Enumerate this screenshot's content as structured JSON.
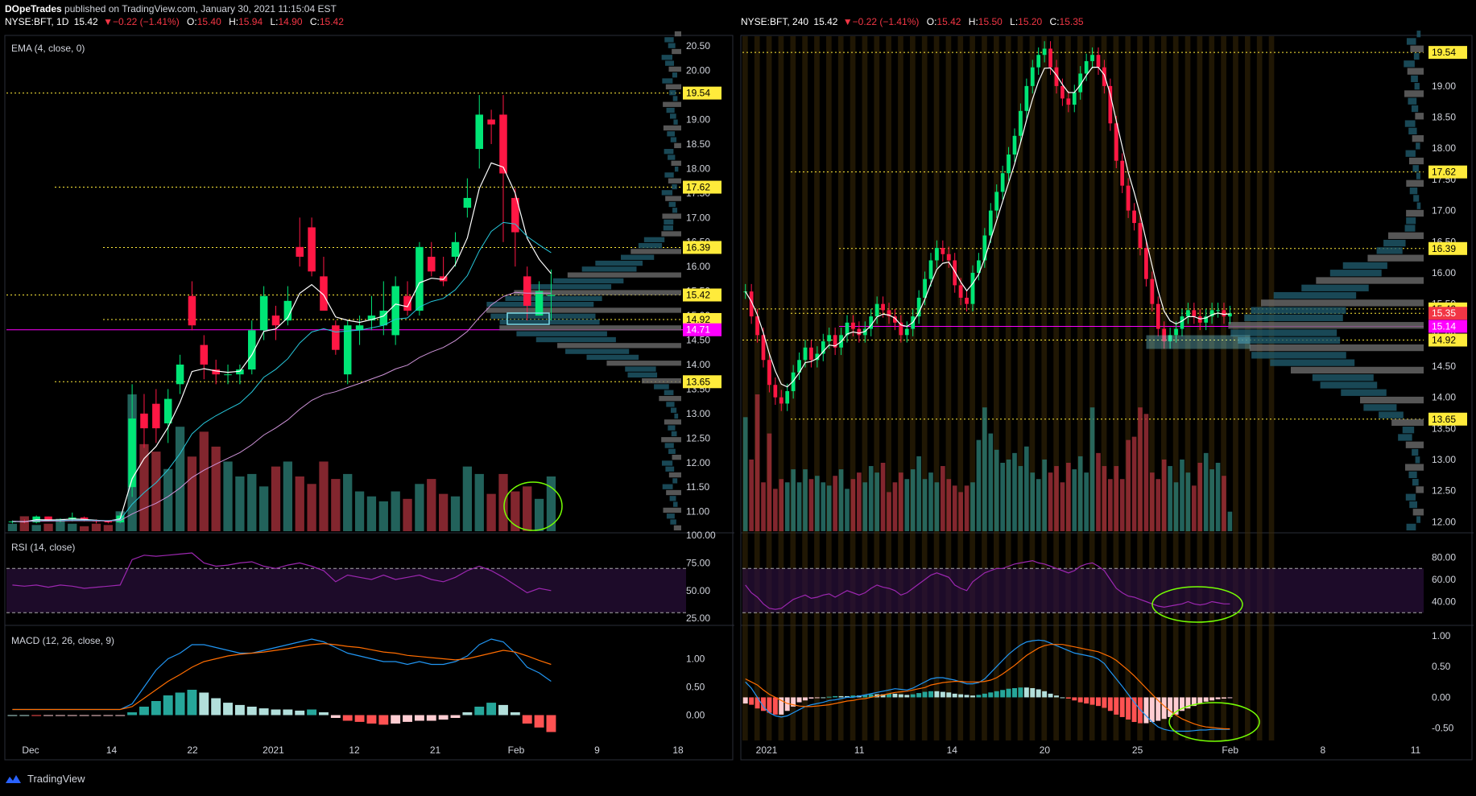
{
  "header": {
    "publisher": "DOpeTrades",
    "published_text": "published on TradingView.com, January 30, 2021 11:15:04 EST"
  },
  "left_info": {
    "symbol": "NYSE:BFT, 1D",
    "price": "15.42",
    "change": "−0.22 (−1.41%)",
    "o": "15.40",
    "h": "15.94",
    "l": "14.90",
    "c": "15.42"
  },
  "right_info": {
    "symbol": "NYSE:BFT, 240",
    "price": "15.42",
    "change": "−0.22 (−1.41%)",
    "o": "15.42",
    "h": "15.50",
    "l": "15.20",
    "c": "15.35"
  },
  "footer": {
    "brand": "TradingView"
  },
  "colors": {
    "up": "#00e676",
    "down": "#ff1744",
    "ema_short": "#ffffff",
    "ema_mid": "#26c6da",
    "ema_long": "#ce93d8",
    "hline": "#ffeb3b",
    "magenta": "#ff00ff",
    "rsi": "#9c27b0",
    "macd": "#2196f3",
    "signal": "#ff6d00"
  },
  "chart_data": [
    {
      "type": "candlestick",
      "panel": "left",
      "timeframe": "1D",
      "indicator_label": "EMA (4, close, 0)",
      "y_ticks": [
        "20.50",
        "20.00",
        "19.50",
        "19.00",
        "18.50",
        "18.00",
        "17.50",
        "17.00",
        "16.50",
        "16.00",
        "15.50",
        "15.00",
        "14.50",
        "14.00",
        "13.50",
        "13.00",
        "12.50",
        "12.00",
        "11.50",
        "11.00"
      ],
      "x_ticks": [
        "Dec",
        "14",
        "22",
        "2021",
        "12",
        "21",
        "Feb",
        "9",
        "18"
      ],
      "price_labels": [
        {
          "v": 19.54,
          "label": "19.54"
        },
        {
          "v": 17.62,
          "label": "17.62"
        },
        {
          "v": 16.39,
          "label": "16.39"
        },
        {
          "v": 15.42,
          "label": "15.42"
        },
        {
          "v": 15.42,
          "label": "15.42"
        },
        {
          "v": 14.92,
          "label": "14.92"
        },
        {
          "v": 14.71,
          "label": "14.71"
        },
        {
          "v": 13.65,
          "label": "13.65"
        }
      ],
      "candles": [
        [
          10.8,
          10.82,
          10.76,
          10.8
        ],
        [
          10.8,
          10.84,
          10.76,
          10.78
        ],
        [
          10.78,
          10.92,
          10.76,
          10.9
        ],
        [
          10.9,
          10.9,
          10.8,
          10.82
        ],
        [
          10.82,
          10.86,
          10.78,
          10.84
        ],
        [
          10.84,
          10.98,
          10.8,
          10.88
        ],
        [
          10.88,
          10.9,
          10.8,
          10.82
        ],
        [
          10.82,
          10.84,
          10.76,
          10.8
        ],
        [
          10.8,
          10.82,
          10.76,
          10.78
        ],
        [
          10.78,
          10.98,
          10.76,
          10.92
        ],
        [
          11.5,
          13.6,
          11.3,
          12.9
        ],
        [
          13.0,
          13.4,
          12.3,
          12.7
        ],
        [
          13.2,
          13.5,
          12.4,
          12.7
        ],
        [
          12.8,
          13.5,
          12.4,
          13.3
        ],
        [
          13.6,
          14.2,
          13.4,
          14.0
        ],
        [
          15.4,
          15.7,
          14.7,
          14.8
        ],
        [
          14.4,
          14.6,
          13.7,
          14.0
        ],
        [
          13.9,
          14.1,
          13.6,
          13.8
        ],
        [
          13.8,
          14.0,
          13.6,
          13.8
        ],
        [
          13.8,
          14.0,
          13.6,
          13.9
        ],
        [
          13.9,
          14.9,
          13.8,
          14.7
        ],
        [
          14.7,
          15.6,
          14.5,
          15.4
        ],
        [
          15.0,
          15.2,
          14.5,
          14.8
        ],
        [
          14.9,
          15.6,
          14.8,
          15.3
        ],
        [
          16.4,
          17.0,
          16.0,
          16.2
        ],
        [
          16.8,
          17.0,
          15.8,
          15.9
        ],
        [
          15.8,
          16.2,
          15.1,
          15.1
        ],
        [
          14.8,
          14.9,
          14.2,
          14.3
        ],
        [
          13.8,
          14.9,
          13.6,
          14.8
        ],
        [
          14.7,
          15.0,
          14.4,
          14.8
        ],
        [
          14.9,
          15.4,
          14.7,
          15.0
        ],
        [
          14.8,
          15.7,
          14.6,
          15.1
        ],
        [
          14.6,
          15.8,
          14.4,
          15.6
        ],
        [
          15.4,
          15.7,
          15.0,
          15.1
        ],
        [
          15.1,
          16.5,
          15.0,
          16.4
        ],
        [
          16.2,
          16.5,
          15.8,
          15.9
        ],
        [
          15.8,
          16.2,
          15.6,
          15.7
        ],
        [
          16.2,
          16.7,
          16.0,
          16.5
        ],
        [
          17.2,
          17.8,
          17.0,
          17.4
        ],
        [
          18.4,
          19.5,
          18.0,
          19.1
        ],
        [
          19.0,
          19.2,
          18.5,
          18.9
        ],
        [
          19.1,
          19.5,
          16.5,
          17.9
        ],
        [
          17.4,
          17.6,
          16.0,
          16.7
        ],
        [
          15.8,
          16.0,
          14.9,
          15.2
        ],
        [
          15.0,
          15.7,
          15.0,
          15.5
        ],
        [
          15.4,
          15.94,
          14.9,
          15.42
        ]
      ],
      "volume": [
        0.3,
        0.6,
        0.25,
        0.3,
        0.5,
        0.3,
        0.2,
        0.3,
        0.25,
        0.8,
        5.5,
        3.5,
        3.2,
        2.5,
        4.2,
        3.0,
        4.0,
        3.4,
        2.8,
        2.2,
        2.3,
        1.8,
        2.6,
        2.8,
        2.2,
        1.9,
        2.8,
        2.1,
        2.3,
        1.6,
        1.4,
        1.2,
        1.6,
        1.3,
        1.9,
        2.1,
        1.5,
        1.4,
        2.6,
        2.3,
        1.5,
        2.3,
        1.6,
        1.8,
        1.3,
        2.2
      ],
      "rsi": {
        "label": "RSI (14, close)",
        "y_ticks": [
          "100.00",
          "75.00",
          "50.00",
          "25.00"
        ],
        "bands": [
          30,
          70
        ],
        "values": [
          55,
          54,
          55,
          53,
          55,
          54,
          52,
          53,
          54,
          55,
          78,
          82,
          81,
          82,
          83,
          84,
          75,
          72,
          73,
          75,
          76,
          72,
          70,
          73,
          75,
          72,
          68,
          58,
          64,
          62,
          60,
          64,
          60,
          62,
          64,
          60,
          58,
          62,
          68,
          72,
          68,
          62,
          55,
          48,
          52,
          50
        ]
      },
      "macd": {
        "label": "MACD (12, 26, close, 9)",
        "y_ticks": [
          "1.00",
          "0.50",
          "0.00"
        ],
        "macd": [
          0.1,
          0.1,
          0.1,
          0.1,
          0.1,
          0.1,
          0.1,
          0.1,
          0.1,
          0.1,
          0.2,
          0.5,
          0.8,
          1.0,
          1.1,
          1.25,
          1.25,
          1.2,
          1.15,
          1.1,
          1.1,
          1.15,
          1.2,
          1.25,
          1.3,
          1.35,
          1.3,
          1.2,
          1.1,
          1.05,
          1.0,
          0.95,
          0.95,
          0.9,
          0.95,
          0.9,
          0.9,
          0.95,
          1.05,
          1.25,
          1.35,
          1.3,
          1.1,
          0.85,
          0.75,
          0.6
        ],
        "signal": [
          0.1,
          0.1,
          0.1,
          0.1,
          0.1,
          0.1,
          0.1,
          0.1,
          0.1,
          0.1,
          0.15,
          0.3,
          0.45,
          0.6,
          0.72,
          0.85,
          0.95,
          1.0,
          1.05,
          1.08,
          1.1,
          1.12,
          1.15,
          1.18,
          1.22,
          1.25,
          1.27,
          1.25,
          1.22,
          1.2,
          1.16,
          1.12,
          1.1,
          1.06,
          1.04,
          1.02,
          1.0,
          0.98,
          1.0,
          1.05,
          1.1,
          1.15,
          1.12,
          1.05,
          0.97,
          0.9
        ],
        "hist": [
          0,
          0,
          -0.01,
          -0.01,
          -0.01,
          -0.01,
          -0.01,
          -0.01,
          -0.01,
          -0.01,
          0.05,
          0.15,
          0.25,
          0.35,
          0.4,
          0.45,
          0.4,
          0.3,
          0.22,
          0.18,
          0.15,
          0.12,
          0.1,
          0.1,
          0.08,
          0.1,
          0.05,
          -0.05,
          -0.1,
          -0.12,
          -0.15,
          -0.17,
          -0.15,
          -0.12,
          -0.1,
          -0.1,
          -0.08,
          -0.05,
          0.05,
          0.15,
          0.22,
          0.18,
          0.05,
          -0.15,
          -0.22,
          -0.3
        ]
      }
    },
    {
      "type": "candlestick",
      "panel": "right",
      "timeframe": "240",
      "y_ticks": [
        "19.50",
        "19.00",
        "18.50",
        "18.00",
        "17.50",
        "17.00",
        "16.50",
        "16.00",
        "15.50",
        "15.00",
        "14.50",
        "14.00",
        "13.50",
        "13.00",
        "12.50",
        "12.00"
      ],
      "x_ticks": [
        "2021",
        "11",
        "14",
        "20",
        "25",
        "Feb",
        "8",
        "11"
      ],
      "price_labels": [
        {
          "v": 19.54,
          "label": "19.54"
        },
        {
          "v": 17.62,
          "label": "17.62"
        },
        {
          "v": 16.39,
          "label": "16.39"
        },
        {
          "v": 15.42,
          "label": "15.42"
        },
        {
          "v": 15.35,
          "label": "15.35"
        },
        {
          "v": 15.14,
          "label": "15.14"
        },
        {
          "v": 14.92,
          "label": "14.92"
        },
        {
          "v": 13.65,
          "label": "13.65"
        }
      ],
      "closes": [
        15.7,
        15.3,
        15.0,
        14.6,
        14.2,
        14.0,
        13.9,
        14.1,
        14.4,
        14.6,
        14.8,
        14.6,
        14.7,
        14.9,
        15.0,
        14.8,
        15.0,
        15.2,
        15.1,
        15.0,
        15.1,
        15.3,
        15.5,
        15.4,
        15.3,
        15.2,
        15.0,
        15.1,
        15.3,
        15.6,
        15.9,
        16.2,
        16.4,
        16.3,
        16.2,
        15.8,
        15.6,
        15.5,
        16.0,
        16.2,
        16.6,
        17.0,
        17.3,
        17.6,
        17.9,
        18.2,
        18.6,
        19.0,
        19.3,
        19.5,
        19.6,
        19.3,
        19.0,
        18.8,
        18.7,
        18.9,
        19.2,
        19.4,
        19.5,
        19.3,
        19.0,
        18.4,
        17.8,
        17.4,
        17.0,
        16.8,
        16.4,
        15.9,
        15.5,
        15.1,
        14.9,
        15.0,
        15.1,
        15.3,
        15.4,
        15.3,
        15.2,
        15.3,
        15.4,
        15.4,
        15.3,
        15.35
      ],
      "volume": [
        3.5,
        2.2,
        4.2,
        1.5,
        3.0,
        1.3,
        1.6,
        1.5,
        1.9,
        1.5,
        1.9,
        1.6,
        1.7,
        1.5,
        1.4,
        1.7,
        1.9,
        1.3,
        1.6,
        1.8,
        1.5,
        2.0,
        1.8,
        2.1,
        1.2,
        1.5,
        1.8,
        1.6,
        1.9,
        2.3,
        1.6,
        1.8,
        1.5,
        2.0,
        1.6,
        1.4,
        1.2,
        1.4,
        1.5,
        2.8,
        3.8,
        3.0,
        2.5,
        2.1,
        2.2,
        2.4,
        2.0,
        2.6,
        1.8,
        1.6,
        2.2,
        1.8,
        2.0,
        1.5,
        2.1,
        1.9,
        2.3,
        1.8,
        3.8,
        2.4,
        2.0,
        1.6,
        2.0,
        1.6,
        2.8,
        2.9,
        3.8,
        3.6,
        1.8,
        1.6,
        2.2,
        2.0,
        1.5,
        2.2,
        1.8,
        1.4,
        2.1,
        2.4,
        1.9,
        2.1,
        1.7,
        0.6
      ],
      "rsi": {
        "y_ticks": [
          "80.00",
          "60.00",
          "40.00"
        ],
        "bands": [
          30,
          70
        ],
        "values": [
          55,
          48,
          44,
          38,
          34,
          33,
          34,
          38,
          42,
          44,
          46,
          43,
          44,
          46,
          47,
          44,
          47,
          50,
          48,
          46,
          48,
          52,
          55,
          53,
          52,
          50,
          46,
          48,
          52,
          56,
          60,
          64,
          66,
          64,
          62,
          55,
          52,
          50,
          58,
          62,
          66,
          68,
          70,
          70,
          72,
          74,
          75,
          76,
          77,
          75,
          74,
          72,
          70,
          68,
          66,
          68,
          72,
          74,
          75,
          72,
          68,
          60,
          52,
          48,
          45,
          44,
          42,
          40,
          38,
          36,
          35,
          36,
          37,
          38,
          40,
          38,
          37,
          38,
          40,
          39,
          38,
          38
        ]
      },
      "macd": {
        "y_ticks": [
          "1.00",
          "0.50",
          "0.00",
          "-0.50"
        ],
        "macd": [
          0.25,
          0.15,
          0.0,
          -0.15,
          -0.25,
          -0.3,
          -0.32,
          -0.3,
          -0.25,
          -0.2,
          -0.15,
          -0.12,
          -0.1,
          -0.08,
          -0.05,
          -0.04,
          -0.02,
          0.0,
          0.0,
          0.02,
          0.04,
          0.06,
          0.08,
          0.1,
          0.12,
          0.14,
          0.13,
          0.12,
          0.15,
          0.2,
          0.25,
          0.3,
          0.32,
          0.32,
          0.3,
          0.28,
          0.25,
          0.22,
          0.22,
          0.24,
          0.3,
          0.4,
          0.5,
          0.6,
          0.7,
          0.78,
          0.85,
          0.9,
          0.92,
          0.93,
          0.92,
          0.88,
          0.84,
          0.8,
          0.76,
          0.72,
          0.7,
          0.68,
          0.66,
          0.62,
          0.55,
          0.42,
          0.3,
          0.18,
          0.05,
          -0.08,
          -0.2,
          -0.3,
          -0.4,
          -0.48,
          -0.52,
          -0.54,
          -0.55,
          -0.55,
          -0.55,
          -0.54,
          -0.53,
          -0.53,
          -0.52,
          -0.52,
          -0.52,
          -0.52
        ],
        "signal": [
          0.3,
          0.25,
          0.2,
          0.12,
          0.05,
          0.0,
          -0.05,
          -0.1,
          -0.12,
          -0.14,
          -0.15,
          -0.15,
          -0.14,
          -0.13,
          -0.12,
          -0.1,
          -0.08,
          -0.06,
          -0.05,
          -0.03,
          -0.02,
          0.0,
          0.02,
          0.04,
          0.06,
          0.08,
          0.09,
          0.1,
          0.12,
          0.14,
          0.16,
          0.2,
          0.22,
          0.24,
          0.25,
          0.26,
          0.26,
          0.25,
          0.25,
          0.25,
          0.26,
          0.28,
          0.32,
          0.38,
          0.45,
          0.52,
          0.6,
          0.68,
          0.74,
          0.8,
          0.84,
          0.86,
          0.86,
          0.86,
          0.84,
          0.82,
          0.8,
          0.78,
          0.76,
          0.74,
          0.7,
          0.66,
          0.6,
          0.52,
          0.44,
          0.35,
          0.25,
          0.15,
          0.05,
          -0.05,
          -0.14,
          -0.22,
          -0.29,
          -0.35,
          -0.39,
          -0.43,
          -0.46,
          -0.48,
          -0.49,
          -0.5,
          -0.51,
          -0.51
        ],
        "hist": [
          -0.1,
          -0.12,
          -0.18,
          -0.22,
          -0.25,
          -0.28,
          -0.28,
          -0.22,
          -0.15,
          -0.08,
          -0.05,
          -0.02,
          -0.01,
          0.0,
          0.01,
          0.02,
          0.02,
          0.02,
          0.03,
          0.03,
          0.04,
          0.05,
          0.05,
          0.05,
          0.06,
          0.06,
          0.05,
          0.04,
          0.05,
          0.07,
          0.09,
          0.1,
          0.1,
          0.09,
          0.08,
          0.06,
          0.05,
          0.04,
          0.03,
          0.04,
          0.06,
          0.08,
          0.1,
          0.12,
          0.14,
          0.15,
          0.16,
          0.16,
          0.15,
          0.13,
          0.1,
          0.06,
          0.03,
          0.0,
          -0.02,
          -0.05,
          -0.08,
          -0.1,
          -0.12,
          -0.14,
          -0.17,
          -0.22,
          -0.28,
          -0.32,
          -0.36,
          -0.4,
          -0.42,
          -0.42,
          -0.4,
          -0.38,
          -0.35,
          -0.32,
          -0.28,
          -0.22,
          -0.18,
          -0.14,
          -0.1,
          -0.07,
          -0.05,
          -0.03,
          -0.02,
          -0.01
        ]
      }
    }
  ]
}
